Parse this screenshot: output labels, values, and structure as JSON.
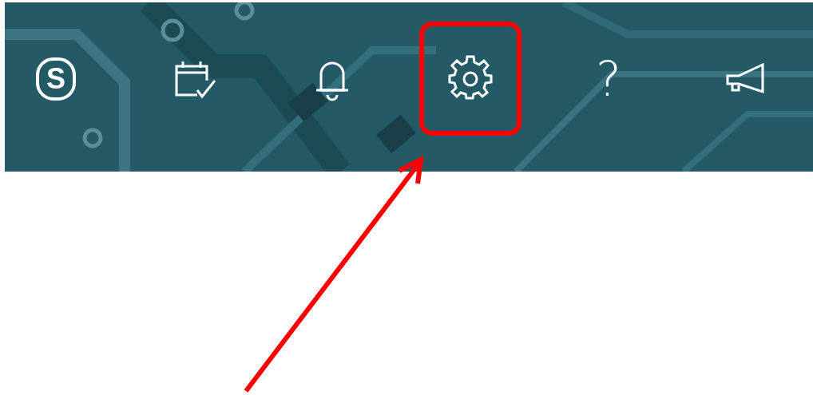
{
  "toolbar": {
    "buttons": [
      {
        "kind": "chat",
        "glyph": "S",
        "highlighted": false
      },
      {
        "kind": "calendar",
        "highlighted": false
      },
      {
        "kind": "bell",
        "highlighted": false
      },
      {
        "kind": "gear",
        "highlighted": true
      },
      {
        "kind": "help",
        "glyph": "?",
        "highlighted": false
      },
      {
        "kind": "megaphone",
        "highlighted": false
      }
    ]
  },
  "annotation": {
    "kind": "arrow"
  }
}
